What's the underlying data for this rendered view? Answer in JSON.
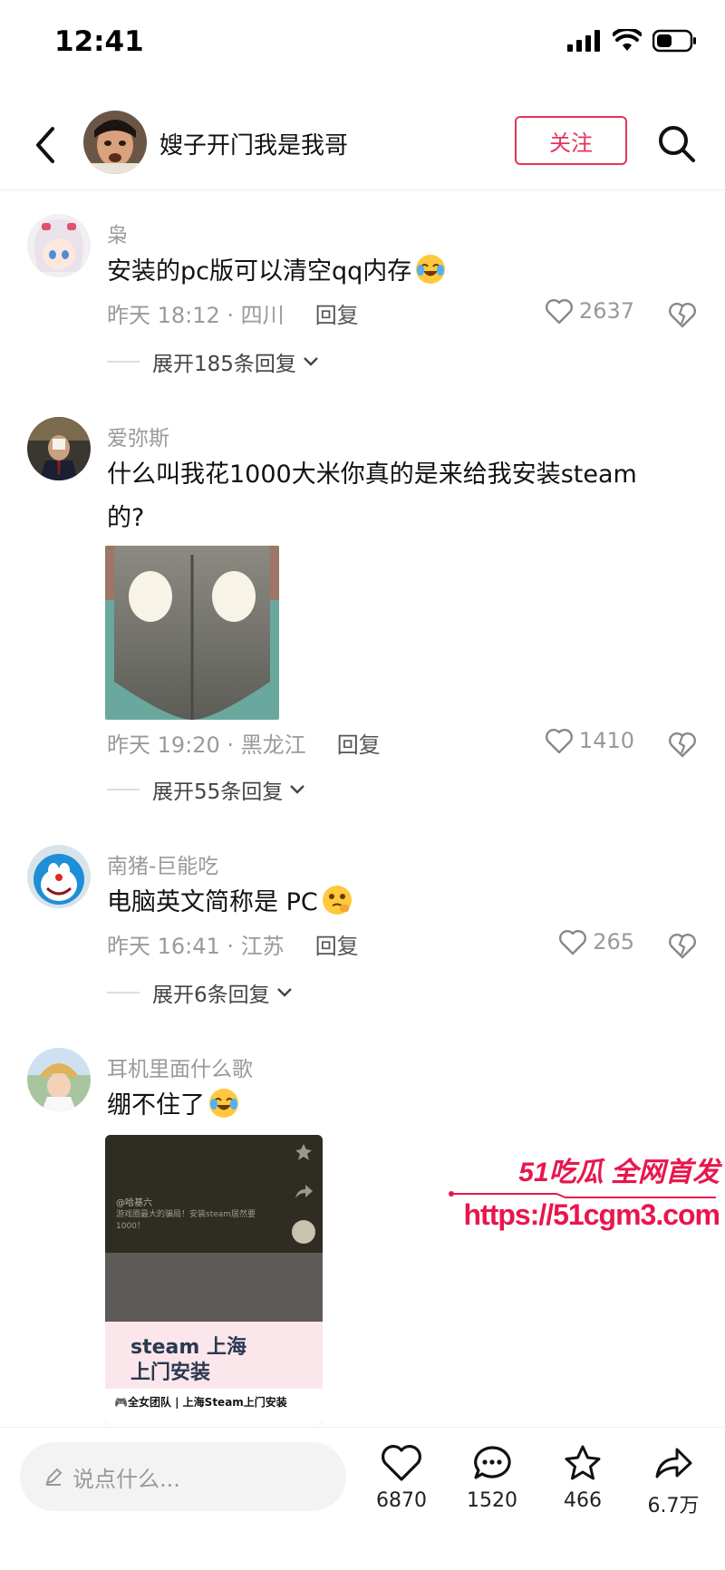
{
  "status_bar": {
    "time": "12:41"
  },
  "header": {
    "title": "嫂子开门我是我哥",
    "follow_label": "关注"
  },
  "comments": [
    {
      "username": "枭",
      "text": "安装的pc版可以清空qq内存",
      "time_location": "昨天 18:12 · 四川",
      "reply_label": "回复",
      "likes": "2637",
      "expand_label": "展开185条回复"
    },
    {
      "username": "爱弥斯",
      "text_line1": "什么叫我花1000大米你真的是来给我安装steam",
      "text_line2": "的?",
      "time_location": "昨天 19:20 · 黑龙江",
      "reply_label": "回复",
      "likes": "1410",
      "expand_label": "展开55条回复"
    },
    {
      "username": "南猪-巨能吃",
      "text": "电脑英文简称是 PC",
      "time_location": "昨天 16:41 · 江苏",
      "reply_label": "回复",
      "likes": "265",
      "expand_label": "展开6条回复"
    },
    {
      "username": "耳机里面什么歌",
      "text": "绷不住了",
      "image": {
        "caption_line1": "steam 上海",
        "caption_line2": "上门安装",
        "title": "🎮全女团队 | 上海Steam上门安装",
        "overlay_user": "@哈基六",
        "overlay_text": "游戏圈最大的骗局！安装steam居然要1000！"
      }
    }
  ],
  "watermark": {
    "brand": "51吃瓜 全网首发",
    "url": "https://51cgm3.com"
  },
  "bottom_bar": {
    "input_placeholder": "说点什么...",
    "likes": "6870",
    "comments": "1520",
    "favorites": "466",
    "shares": "6.7万"
  },
  "colors": {
    "accent": "#e3355c",
    "muted": "#9a9a9a"
  }
}
